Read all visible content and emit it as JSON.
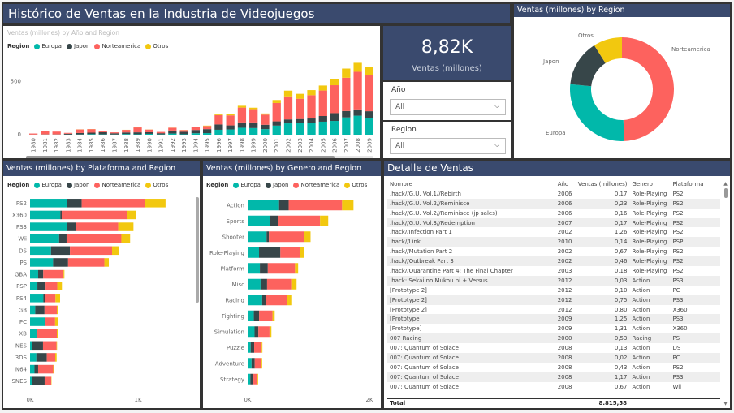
{
  "colors": {
    "Europa": "#01b8aa",
    "Japon": "#374649",
    "Norteamerica": "#fd625e",
    "Otros": "#f2c80f",
    "header": "#3a4a6e"
  },
  "title": "Histórico de Ventas en la Industria de Videojuegos",
  "legend": {
    "title": "Region",
    "items": [
      "Europa",
      "Japon",
      "Norteamerica",
      "Otros"
    ]
  },
  "kpi": {
    "value": "8,82K",
    "label": "Ventas (millones)"
  },
  "slicers": [
    {
      "label": "Año",
      "value": "All"
    },
    {
      "label": "Region",
      "value": "All"
    }
  ],
  "year_chart": {
    "title": "Ventas (millones) by Año and Region",
    "yticks": [
      "500",
      "0"
    ]
  },
  "platform_chart": {
    "title": "Ventas (millones) by Plataforma and Region",
    "xticks": [
      "0K",
      "1K"
    ]
  },
  "genre_chart": {
    "title": "Ventas (millones) by Genero and Region",
    "xticks": [
      "0K",
      "2K"
    ]
  },
  "donut": {
    "title": "Ventas (millones) by Region",
    "labels": [
      "Norteamerica",
      "Europa",
      "Japon",
      "Otros"
    ]
  },
  "detail": {
    "title": "Detalle de Ventas",
    "columns": [
      "Nombre",
      "Año",
      "Ventas (millones)",
      "Genero",
      "Plataforma"
    ],
    "rows": [
      [
        ".hack//G.U. Vol.1//Rebirth",
        "2006",
        "0,17",
        "Role-Playing",
        "PS2"
      ],
      [
        ".hack//G.U. Vol.2//Reminisce",
        "2006",
        "0,23",
        "Role-Playing",
        "PS2"
      ],
      [
        ".hack//G.U. Vol.2//Reminisce (jp sales)",
        "2006",
        "0,16",
        "Role-Playing",
        "PS2"
      ],
      [
        ".hack//G.U. Vol.3//Redemption",
        "2007",
        "0,17",
        "Role-Playing",
        "PS2"
      ],
      [
        ".hack//Infection Part 1",
        "2002",
        "1,26",
        "Role-Playing",
        "PS2"
      ],
      [
        ".hack//Link",
        "2010",
        "0,14",
        "Role-Playing",
        "PSP"
      ],
      [
        ".hack//Mutation Part 2",
        "2002",
        "0,67",
        "Role-Playing",
        "PS2"
      ],
      [
        ".hack//Outbreak Part 3",
        "2002",
        "0,46",
        "Role-Playing",
        "PS2"
      ],
      [
        ".hack//Quarantine Part 4: The Final Chapter",
        "2003",
        "0,18",
        "Role-Playing",
        "PS2"
      ],
      [
        ".hack: Sekai no Mukou ni + Versus",
        "2012",
        "0,03",
        "Action",
        "PS3"
      ],
      [
        "[Prototype 2]",
        "2012",
        "0,10",
        "Action",
        "PC"
      ],
      [
        "[Prototype 2]",
        "2012",
        "0,75",
        "Action",
        "PS3"
      ],
      [
        "[Prototype 2]",
        "2012",
        "0,80",
        "Action",
        "X360"
      ],
      [
        "[Prototype]",
        "2009",
        "1,25",
        "Action",
        "PS3"
      ],
      [
        "[Prototype]",
        "2009",
        "1,31",
        "Action",
        "X360"
      ],
      [
        "007 Racing",
        "2000",
        "0,53",
        "Racing",
        "PS"
      ],
      [
        "007: Quantum of Solace",
        "2008",
        "0,13",
        "Action",
        "DS"
      ],
      [
        "007: Quantum of Solace",
        "2008",
        "0,02",
        "Action",
        "PC"
      ],
      [
        "007: Quantum of Solace",
        "2008",
        "0,43",
        "Action",
        "PS2"
      ],
      [
        "007: Quantum of Solace",
        "2008",
        "1,17",
        "Action",
        "PS3"
      ],
      [
        "007: Quantum of Solace",
        "2008",
        "0,67",
        "Action",
        "Wii"
      ]
    ],
    "total": {
      "label": "Total",
      "value": "8.815,58"
    }
  },
  "chart_data": [
    {
      "type": "bar",
      "title": "Ventas (millones) by Año and Region",
      "stacked": true,
      "categories": [
        "1980",
        "1981",
        "1982",
        "1983",
        "1984",
        "1985",
        "1986",
        "1987",
        "1988",
        "1989",
        "1990",
        "1991",
        "1992",
        "1993",
        "1994",
        "1995",
        "1996",
        "1997",
        "1998",
        "1999",
        "2000",
        "2001",
        "2002",
        "2003",
        "2004",
        "2005",
        "2006",
        "2007",
        "2008",
        "2009"
      ],
      "series": [
        {
          "name": "Europa",
          "values": [
            1,
            2,
            2,
            1,
            2,
            5,
            3,
            2,
            6,
            4,
            8,
            3,
            11,
            4,
            14,
            15,
            46,
            49,
            65,
            62,
            52,
            85,
            106,
            112,
            110,
            122,
            129,
            162,
            178,
            158
          ]
        },
        {
          "name": "Japon",
          "values": [
            0,
            0,
            0,
            8,
            14,
            14,
            20,
            11,
            15,
            18,
            15,
            11,
            28,
            23,
            30,
            37,
            50,
            38,
            50,
            53,
            41,
            40,
            37,
            35,
            42,
            53,
            73,
            60,
            59,
            62
          ]
        },
        {
          "name": "Norteamerica",
          "values": [
            10,
            29,
            27,
            8,
            33,
            33,
            13,
            9,
            24,
            46,
            25,
            12,
            26,
            16,
            28,
            29,
            88,
            94,
            139,
            124,
            95,
            172,
            216,
            190,
            218,
            239,
            262,
            312,
            353,
            339
          ]
        },
        {
          "name": "Otros",
          "values": [
            0,
            0,
            0,
            0,
            1,
            1,
            1,
            0,
            1,
            1,
            1,
            0,
            1,
            1,
            2,
            4,
            8,
            11,
            17,
            14,
            11,
            28,
            54,
            46,
            48,
            47,
            61,
            86,
            84,
            78
          ]
        }
      ],
      "ylim": [
        0,
        700
      ],
      "yticks": [
        0,
        500
      ]
    },
    {
      "type": "bar",
      "orientation": "horizontal",
      "stacked": true,
      "title": "Ventas (millones) by Plataforma and Region",
      "categories": [
        "PS2",
        "X360",
        "PS3",
        "Wii",
        "DS",
        "PS",
        "GBA",
        "PSP",
        "PS4",
        "GB",
        "PC",
        "XB",
        "NES",
        "3DS",
        "N64",
        "SNES"
      ],
      "series": [
        {
          "name": "Europa",
          "values": [
            339,
            280,
            343,
            269,
            194,
            213,
            75,
            68,
            123,
            48,
            139,
            60,
            22,
            58,
            41,
            19
          ]
        },
        {
          "name": "Japon",
          "values": [
            139,
            13,
            80,
            69,
            175,
            139,
            47,
            76,
            15,
            86,
            0,
            1,
            98,
            97,
            34,
            116
          ]
        },
        {
          "name": "Norteamerica",
          "values": [
            583,
            602,
            393,
            507,
            390,
            336,
            188,
            108,
            97,
            114,
            93,
            187,
            125,
            78,
            139,
            61
          ]
        },
        {
          "name": "Otros",
          "values": [
            193,
            85,
            141,
            81,
            61,
            41,
            8,
            43,
            43,
            8,
            24,
            9,
            5,
            13,
            4,
            3
          ]
        }
      ],
      "xlim": [
        0,
        1300
      ],
      "xticks": [
        "0K",
        "1K"
      ]
    },
    {
      "type": "bar",
      "orientation": "horizontal",
      "stacked": true,
      "title": "Ventas (millones) by Genero and Region",
      "categories": [
        "Action",
        "Sports",
        "Shooter",
        "Role-Playing",
        "Platform",
        "Misc",
        "Racing",
        "Fighting",
        "Simulation",
        "Puzzle",
        "Adventure",
        "Strategy"
      ],
      "series": [
        {
          "name": "Europa",
          "values": [
            516,
            371,
            311,
            187,
            201,
            212,
            238,
            101,
            113,
            50,
            64,
            45
          ]
        },
        {
          "name": "Japon",
          "values": [
            158,
            135,
            38,
            350,
            130,
            107,
            56,
            87,
            63,
            57,
            52,
            49
          ]
        },
        {
          "name": "Norteamerica",
          "values": [
            877,
            683,
            582,
            327,
            447,
            410,
            359,
            220,
            183,
            123,
            105,
            68
          ]
        },
        {
          "name": "Otros",
          "values": [
            187,
            134,
            102,
            59,
            51,
            74,
            77,
            36,
            31,
            12,
            17,
            11
          ]
        }
      ],
      "xlim": [
        0,
        2000
      ],
      "xticks": [
        "0K",
        "2K"
      ]
    },
    {
      "type": "pie",
      "donut": true,
      "title": "Ventas (millones) by Region",
      "categories": [
        "Norteamerica",
        "Europa",
        "Japon",
        "Otros"
      ],
      "values": [
        4393,
        2434,
        1291,
        798
      ]
    }
  ]
}
